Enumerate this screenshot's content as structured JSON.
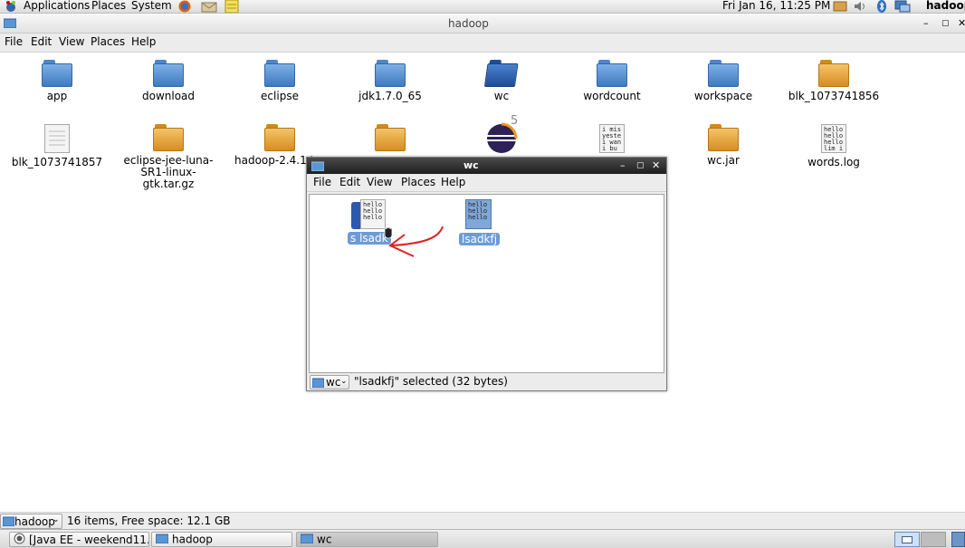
{
  "topbar": {
    "applications": "Applications",
    "places": "Places",
    "system": "System",
    "clock": "Fri Jan 16, 11:25 PM",
    "user": "hadoop"
  },
  "window": {
    "title": "hadoop",
    "menu": [
      "File",
      "Edit",
      "View",
      "Places",
      "Help"
    ],
    "status_location": "hadoop",
    "status_text": "16 items, Free space: 12.1 GB"
  },
  "files": [
    {
      "name": "app",
      "icon": "folder-blue"
    },
    {
      "name": "download",
      "icon": "folder-blue"
    },
    {
      "name": "eclipse",
      "icon": "folder-blue"
    },
    {
      "name": "jdk1.7.0_65",
      "icon": "folder-blue"
    },
    {
      "name": "wc",
      "icon": "folder-blue-open"
    },
    {
      "name": "wordcount",
      "icon": "folder-blue"
    },
    {
      "name": "workspace",
      "icon": "folder-blue"
    },
    {
      "name": "blk_1073741856",
      "icon": "archive"
    },
    {
      "name": "blk_1073741857",
      "icon": "text-file"
    },
    {
      "name": "eclipse-jee-luna-SR1-linux-gtk.tar.gz",
      "name_line1": "eclipse-jee-luna-",
      "name_line2": "SR1-linux-gtk.tar.gz",
      "icon": "archive"
    },
    {
      "name": "hadoop-2.4.1.ta",
      "icon": "archive"
    },
    {
      "name": "",
      "icon": "archive"
    },
    {
      "name": "",
      "icon": "eclipse-app"
    },
    {
      "name": "",
      "icon": "text-preview",
      "preview": [
        "i mis",
        "yeste",
        "i wan",
        "i bu"
      ]
    },
    {
      "name": "wc.jar",
      "icon": "archive"
    },
    {
      "name": "words.log",
      "icon": "text-preview",
      "preview": [
        "hello",
        "hello",
        "hello",
        "lim i"
      ]
    }
  ],
  "wc_window": {
    "title": "wc",
    "menu": [
      "File",
      "Edit",
      "View",
      "Places",
      "Help"
    ],
    "items": [
      {
        "label": "lsadk",
        "label_prefix": "s",
        "preview": [
          "hello",
          "hello",
          "hello"
        ]
      },
      {
        "label": "lsadkfj",
        "preview": [
          "hello",
          "hello",
          "hello"
        ]
      }
    ],
    "location": "wc",
    "status": "\"lsadkfj\" selected (32 bytes)"
  },
  "taskbar": [
    {
      "label": "[Java EE - weekend11...",
      "icon": "eclipse-icon"
    },
    {
      "label": "hadoop",
      "icon": "folder-icon"
    },
    {
      "label": "wc",
      "icon": "folder-icon",
      "active": true
    }
  ],
  "colors": {
    "folder_blue": "#5a96d6",
    "folder_orange": "#e5a33d",
    "selection": "#6c9bd6",
    "annotation_arrow": "#e02020"
  }
}
